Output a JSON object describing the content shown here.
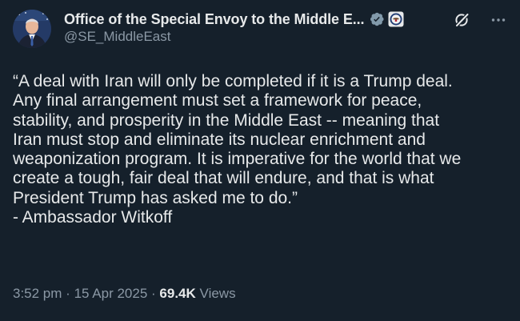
{
  "account": {
    "display_name": "Office of the Special Envoy to the Middle E...",
    "handle": "@SE_MiddleEast",
    "verified_badge_icon": "gray-verified-badge-icon",
    "affiliation_icon": "government-seal-icon"
  },
  "tweet": {
    "lines": [
      "“A deal with Iran will only be completed if it is a Trump deal.",
      "Any final arrangement must set a framework for peace,",
      "stability, and prosperity in the Middle East -- meaning that",
      "Iran must stop and eliminate its nuclear enrichment and",
      "weaponization program. It is imperative for the world that we",
      "create a tough, fair deal that will endure, and that is what",
      "President Trump has asked me to do.”",
      "- Ambassador Witkoff"
    ]
  },
  "meta": {
    "time": "3:52 pm",
    "separator": "·",
    "date": "15 Apr 2025",
    "views_count": "69.4K",
    "views_label": "Views"
  },
  "colors": {
    "background": "#15202b",
    "text_primary": "#e7e9ea",
    "text_secondary": "#8b98a5",
    "badge": "#829aab"
  }
}
